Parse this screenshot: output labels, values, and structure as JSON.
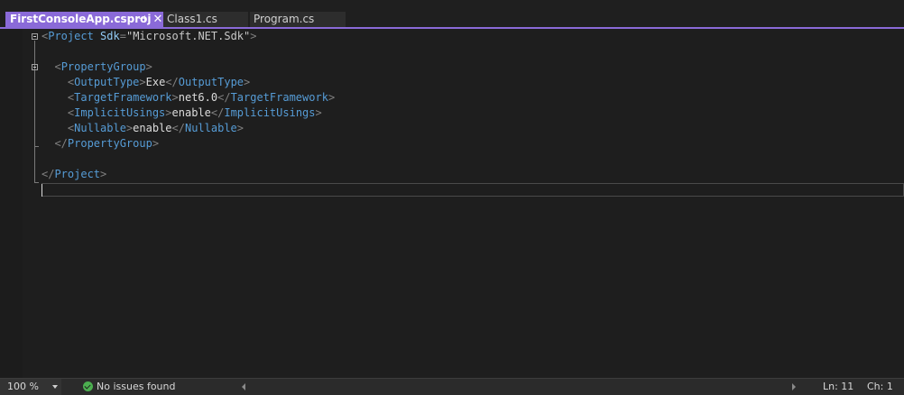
{
  "tabs": [
    {
      "label": "FirstConsoleApp.csproj",
      "active": true,
      "pinned": true,
      "closable": true
    },
    {
      "label": "Class1.cs",
      "active": false
    },
    {
      "label": "Program.cs",
      "active": false
    }
  ],
  "editor": {
    "lines": [
      {
        "name": "project-open-line",
        "tokens": [
          {
            "t": "bracket",
            "v": "<"
          },
          {
            "t": "tag",
            "v": "Project"
          },
          {
            "t": "text",
            "v": " "
          },
          {
            "t": "attr",
            "v": "Sdk"
          },
          {
            "t": "eq",
            "v": "="
          },
          {
            "t": "str",
            "v": "\"Microsoft.NET.Sdk\""
          },
          {
            "t": "bracket",
            "v": ">"
          }
        ]
      },
      {
        "name": "blank-line",
        "tokens": []
      },
      {
        "name": "propertygroup-open-line",
        "tokens": [
          {
            "t": "text",
            "v": "  "
          },
          {
            "t": "bracket",
            "v": "<"
          },
          {
            "t": "tag",
            "v": "PropertyGroup"
          },
          {
            "t": "bracket",
            "v": ">"
          }
        ]
      },
      {
        "name": "outputtype-line",
        "tokens": [
          {
            "t": "text",
            "v": "    "
          },
          {
            "t": "bracket",
            "v": "<"
          },
          {
            "t": "tag",
            "v": "OutputType"
          },
          {
            "t": "bracket",
            "v": ">"
          },
          {
            "t": "text",
            "v": "Exe"
          },
          {
            "t": "bracket",
            "v": "</"
          },
          {
            "t": "tag",
            "v": "OutputType"
          },
          {
            "t": "bracket",
            "v": ">"
          }
        ]
      },
      {
        "name": "targetframework-line",
        "tokens": [
          {
            "t": "text",
            "v": "    "
          },
          {
            "t": "bracket",
            "v": "<"
          },
          {
            "t": "tag",
            "v": "TargetFramework"
          },
          {
            "t": "bracket",
            "v": ">"
          },
          {
            "t": "text",
            "v": "net6.0"
          },
          {
            "t": "bracket",
            "v": "</"
          },
          {
            "t": "tag",
            "v": "TargetFramework"
          },
          {
            "t": "bracket",
            "v": ">"
          }
        ]
      },
      {
        "name": "implicitusings-line",
        "tokens": [
          {
            "t": "text",
            "v": "    "
          },
          {
            "t": "bracket",
            "v": "<"
          },
          {
            "t": "tag",
            "v": "ImplicitUsings"
          },
          {
            "t": "bracket",
            "v": ">"
          },
          {
            "t": "text",
            "v": "enable"
          },
          {
            "t": "bracket",
            "v": "</"
          },
          {
            "t": "tag",
            "v": "ImplicitUsings"
          },
          {
            "t": "bracket",
            "v": ">"
          }
        ]
      },
      {
        "name": "nullable-line",
        "tokens": [
          {
            "t": "text",
            "v": "    "
          },
          {
            "t": "bracket",
            "v": "<"
          },
          {
            "t": "tag",
            "v": "Nullable"
          },
          {
            "t": "bracket",
            "v": ">"
          },
          {
            "t": "text",
            "v": "enable"
          },
          {
            "t": "bracket",
            "v": "</"
          },
          {
            "t": "tag",
            "v": "Nullable"
          },
          {
            "t": "bracket",
            "v": ">"
          }
        ]
      },
      {
        "name": "propertygroup-close-line",
        "tokens": [
          {
            "t": "text",
            "v": "  "
          },
          {
            "t": "bracket",
            "v": "</"
          },
          {
            "t": "tag",
            "v": "PropertyGroup"
          },
          {
            "t": "bracket",
            "v": ">"
          }
        ]
      },
      {
        "name": "blank-line",
        "tokens": []
      },
      {
        "name": "project-close-line",
        "tokens": [
          {
            "t": "bracket",
            "v": "</"
          },
          {
            "t": "tag",
            "v": "Project"
          },
          {
            "t": "bracket",
            "v": ">"
          }
        ]
      },
      {
        "name": "current-line",
        "tokens": []
      }
    ]
  },
  "statusbar": {
    "zoom": "100 %",
    "issues": "No issues found",
    "ln": "Ln: 11",
    "ch": "Ch: 1"
  },
  "colors": {
    "accent": "#8a6ad8",
    "tag": "#569cd6",
    "attr": "#92caf4",
    "bracket": "#808080",
    "ok": "#4caf50"
  }
}
